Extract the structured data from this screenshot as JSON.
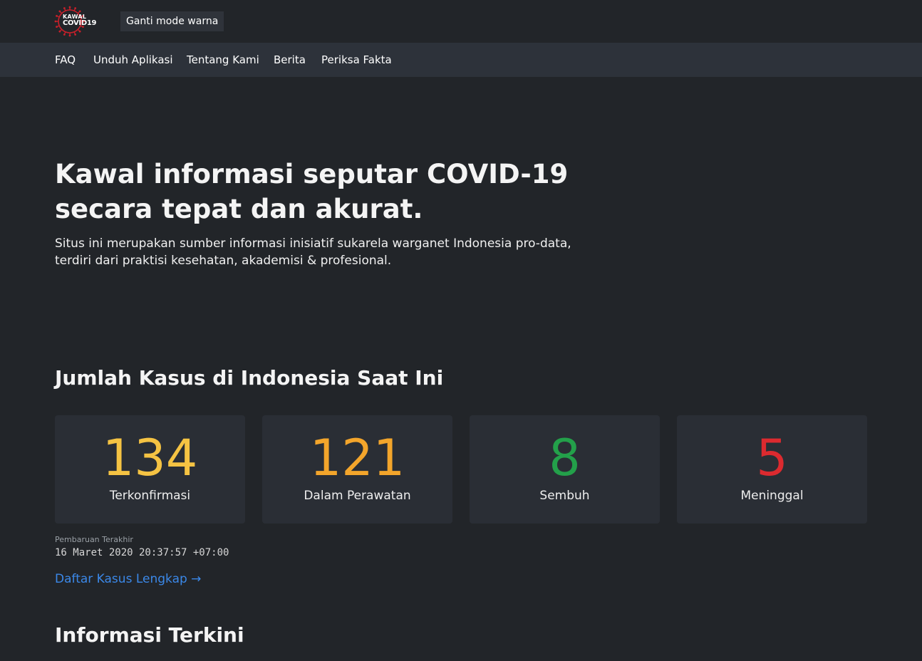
{
  "header": {
    "logo": {
      "line1": "KAWAL",
      "line2": "COVID19",
      "accent": "#c8202a"
    },
    "mode_button": "Ganti mode warna"
  },
  "nav": {
    "items": [
      {
        "label": "FAQ"
      },
      {
        "label": "Unduh Aplikasi"
      },
      {
        "label": "Tentang Kami"
      },
      {
        "label": "Berita"
      },
      {
        "label": "Periksa Fakta"
      }
    ]
  },
  "hero": {
    "title_line1": "Kawal informasi seputar COVID-19",
    "title_line2": "secara tepat dan akurat.",
    "subtitle_line1": "Situs ini merupakan sumber informasi inisiatif sukarela warganet Indonesia pro-data,",
    "subtitle_line2": "terdiri dari praktisi kesehatan, akademisi & profesional."
  },
  "cases": {
    "title": "Jumlah Kasus di Indonesia Saat Ini",
    "stats": [
      {
        "value": "134",
        "label": "Terkonfirmasi",
        "color": "#f5c343"
      },
      {
        "value": "121",
        "label": "Dalam Perawatan",
        "color": "#f3a52b"
      },
      {
        "value": "8",
        "label": "Sembuh",
        "color": "#23a04a"
      },
      {
        "value": "5",
        "label": "Meninggal",
        "color": "#dc2a2f"
      }
    ],
    "update_label": "Pembaruan Terakhir",
    "update_time": "16 Maret 2020 20:37:57 +07:00",
    "full_list_link": "Daftar Kasus Lengkap →"
  },
  "news": {
    "title": "Informasi Terkini"
  },
  "colors": {
    "background": "#222529",
    "navbar": "#2d323a",
    "card": "#2a2e35",
    "link": "#3b88e8"
  }
}
